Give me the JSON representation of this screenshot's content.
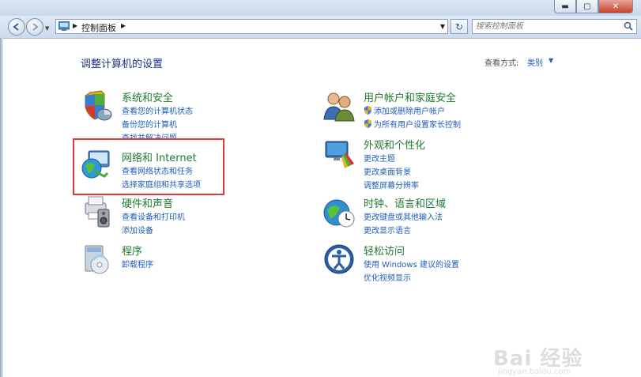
{
  "window": {
    "min_label": "▬",
    "max_label": "▢",
    "close_label": "✕"
  },
  "nav": {
    "breadcrumb": "控制面板",
    "search_placeholder": "搜索控制面板"
  },
  "main": {
    "heading": "调整计算机的设置",
    "view_by_label": "查看方式:",
    "view_by_value": "类别"
  },
  "categories": [
    {
      "title": "系统和安全",
      "links": [
        "查看您的计算机状态",
        "备份您的计算机",
        "查找并解决问题"
      ]
    },
    {
      "title": "网络和 Internet",
      "links": [
        "查看网络状态和任务",
        "选择家庭组和共享选项"
      ]
    },
    {
      "title": "硬件和声音",
      "links": [
        "查看设备和打印机",
        "添加设备"
      ]
    },
    {
      "title": "程序",
      "links": [
        "卸载程序"
      ]
    },
    {
      "title": "用户帐户和家庭安全",
      "links": [
        "添加或删除用户帐户",
        "为所有用户设置家长控制"
      ]
    },
    {
      "title": "外观和个性化",
      "links": [
        "更改主题",
        "更改桌面背景",
        "调整屏幕分辨率"
      ]
    },
    {
      "title": "时钟、语言和区域",
      "links": [
        "更改键盘或其他输入法",
        "更改显示语言"
      ]
    },
    {
      "title": "轻松访问",
      "links": [
        "使用 Windows 建议的设置",
        "优化视频显示"
      ]
    }
  ],
  "watermark": {
    "brand": "Bai 经验",
    "url": "jingyan.baidu.com"
  },
  "colors": {
    "title_green": "#1f7a30",
    "link_blue": "#1e5db9",
    "highlight_red": "#e03a3a"
  }
}
